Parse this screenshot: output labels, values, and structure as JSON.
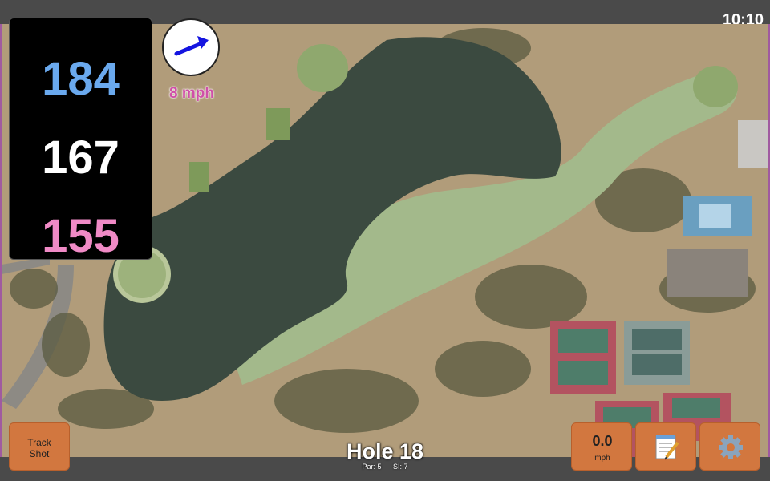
{
  "status_bar": {
    "time": "10:10"
  },
  "distances": {
    "back": "184",
    "middle": "167",
    "front": "155"
  },
  "wind": {
    "speed_label": "8 mph",
    "arrow_icon": "wind-arrow-icon"
  },
  "buttons": {
    "track_shot_line1": "Track",
    "track_shot_line2": "Shot",
    "speed_value": "0.0",
    "speed_unit": "mph",
    "notes_icon": "notepad-icon",
    "settings_icon": "gear-icon"
  },
  "hole": {
    "title": "Hole 18",
    "par": "Par: 5",
    "si": "SI: 7"
  },
  "colors": {
    "back_distance": "#6aa9ee",
    "middle_distance": "#ffffff",
    "front_distance": "#f08ac6",
    "button": "#d2773f",
    "wind_text": "#d04fa8"
  }
}
